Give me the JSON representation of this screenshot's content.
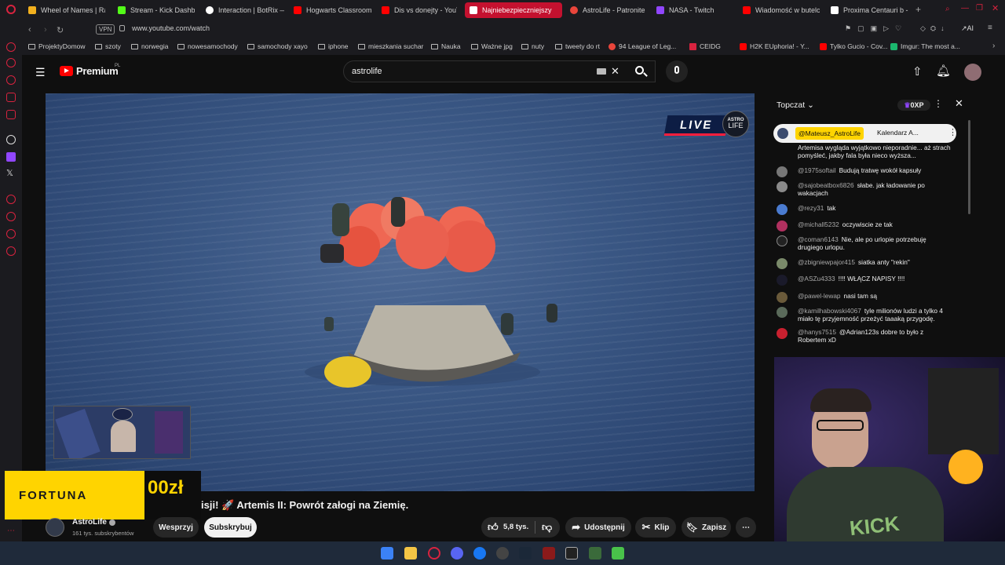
{
  "tabs": [
    {
      "label": "Wheel of Names | Ran",
      "color": "#f2b01e"
    },
    {
      "label": "Stream - Kick Dashbo",
      "color": "#53fc18"
    },
    {
      "label": "Interaction | BotRix —",
      "color": "#ffffff"
    },
    {
      "label": "Hogwarts Classroom",
      "color": "#ff0000"
    },
    {
      "label": "Dis vs donejty - YouT",
      "color": "#ff0000"
    },
    {
      "label": "Najniebezpieczniejszy",
      "color": "#ff0000"
    },
    {
      "label": "AstroLife - Patronite.p",
      "color": "#e9453b"
    },
    {
      "label": "NASA - Twitch",
      "color": "#9146ff"
    },
    {
      "label": "Wiadomość w butelce",
      "color": "#ff0000"
    },
    {
      "label": "Proxima Centauri b - \\",
      "color": "#ffffff"
    }
  ],
  "address": {
    "vpn": "VPN",
    "url": "www.youtube.com/watch"
  },
  "bookmarks": [
    "ProjektyDomow",
    "szoty",
    "norwegia",
    "nowesamochody",
    "samochody xayo",
    "iphone",
    "mieszkania suchar",
    "Nauka",
    "Ważne jpg",
    "nuty",
    "tweety do rt",
    "94 League of Leg...",
    "CEIDG",
    "H2K EUphoria! - Y...",
    "Tylko Gucio - Cov...",
    "Imgur: The most a..."
  ],
  "youtube": {
    "logo": "Premium",
    "region": "PL",
    "search_value": "astrolife"
  },
  "video": {
    "live_badge": "LIVE",
    "astro_badge_top": "ASTRO",
    "astro_badge_bottom": "LIFE",
    "title": "isji! 🚀 Artemis II: Powrót załogi na Ziemię.",
    "ad_brand": "FORTUNA",
    "ad_amount": "00zł"
  },
  "channel": {
    "name": "AstroLife",
    "subs": "161 tys. subskrybentów",
    "support": "Wesprzyj",
    "subscribe": "Subskrybuj"
  },
  "actions": {
    "likes": "5,8 tys.",
    "share": "Udostępnij",
    "clip": "Klip",
    "save": "Zapisz"
  },
  "chat": {
    "mode": "Topczat",
    "xp": "0XP",
    "pinned_author": "@Mateusz_AstroLife",
    "pinned_text": "Kalendarz A...",
    "pinned_body": "Artemisa wygląda wyjątkowo nieporadnie... aż strach pomyśleć, jakby fala była nieco wyższa...",
    "messages": [
      {
        "author": "@1975softail",
        "text": "Budują tratwę wokół kapsuły"
      },
      {
        "author": "@sajobeatbox6826",
        "text": "słabe. jak ładowanie po wakacjach"
      },
      {
        "author": "@rezy31",
        "text": "tak"
      },
      {
        "author": "@michall5232",
        "text": "oczywiscie ze tak"
      },
      {
        "author": "@coman6143",
        "text": "Nie, ale po urlopie potrzebuję drugiego urlopu."
      },
      {
        "author": "@zbigniewpajor415",
        "text": "siatka anty \"rekin\""
      },
      {
        "author": "@ASZu4333",
        "text": "!!!! WŁĄCZ NAPISY !!!!"
      },
      {
        "author": "@pawel-lewap",
        "text": "nasi tam są"
      },
      {
        "author": "@kamilhabowski4067",
        "text": "tyle milionów ludzi a tylko 4 miało tę przyjemność przeżyć taaaką przygodę."
      },
      {
        "author": "@hanys7515",
        "text": "@Adrian123s dobre to było z Robertem xD"
      }
    ]
  },
  "webcam": {
    "shirt_text": "KICK"
  },
  "colors": {
    "accent": "#ff0000",
    "tab_active": "#c4112f",
    "opera": "#d8233f"
  }
}
